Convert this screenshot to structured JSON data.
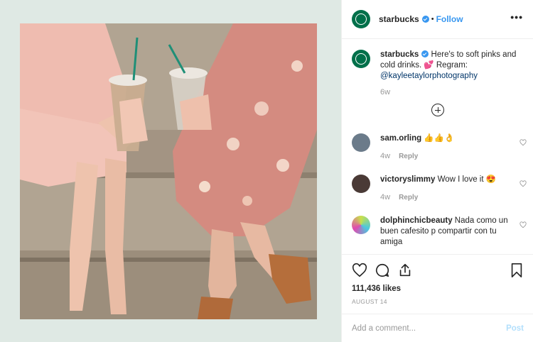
{
  "post": {
    "username": "starbucks",
    "follow_label": "Follow",
    "dot": "•",
    "more_label": "•••"
  },
  "caption": {
    "username": "starbucks",
    "text": "Here's to soft pinks and cold drinks. 💕 Regram:",
    "mention": "@kayleetaylorphotography",
    "age": "6w"
  },
  "comments": [
    {
      "username": "sam.orling",
      "text": "👍👍👌",
      "age": "4w",
      "reply_label": "Reply",
      "avatar_color": "#6b7b8a"
    },
    {
      "username": "victoryslimmy",
      "text": "Wow I love it 😍",
      "age": "4w",
      "reply_label": "Reply",
      "avatar_color": "#4a3a36"
    },
    {
      "username": "dolphinchicbeauty",
      "text": "Nada como un buen cafesito p compartir con tu amiga",
      "avatar_color": "#c9e04a"
    }
  ],
  "actions": {
    "likes": "111,436 likes",
    "date": "AUGUST 14"
  },
  "add_comment": {
    "placeholder": "Add a comment...",
    "post_label": "Post"
  },
  "colors": {
    "brand": "#00704a",
    "link": "#3897f0",
    "muted": "#999999"
  }
}
